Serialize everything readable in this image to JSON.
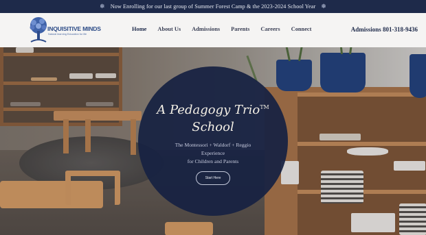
{
  "announcement": {
    "text": "Now Enrolling for our last group of Summer Forest Camp & the 2023-2024 School Year"
  },
  "brand": {
    "name": "INQUISITIVE MINDS",
    "tagline": "Natural learning Education for life"
  },
  "nav": {
    "items": [
      "Home",
      "About Us",
      "Admissions",
      "Parents",
      "Careers",
      "Connect"
    ],
    "active": "Home"
  },
  "contact": {
    "phone_label": "Admissions 801-318-9436"
  },
  "hero": {
    "title_line1": "A Pedagogy Trio",
    "trademark": "TM",
    "title_line2": "School",
    "subtitle_line1": "The Montessori + Waldorf + Reggio Experience",
    "subtitle_line2": "for Children and Parents",
    "cta_label": "Start Here"
  },
  "colors": {
    "navy": "#1e2a4a",
    "circle": "#172242",
    "brand_blue": "#2b4a86",
    "wood": "#c78f5d"
  },
  "icons": [
    "snowflake-icon",
    "tree-logo-icon"
  ]
}
